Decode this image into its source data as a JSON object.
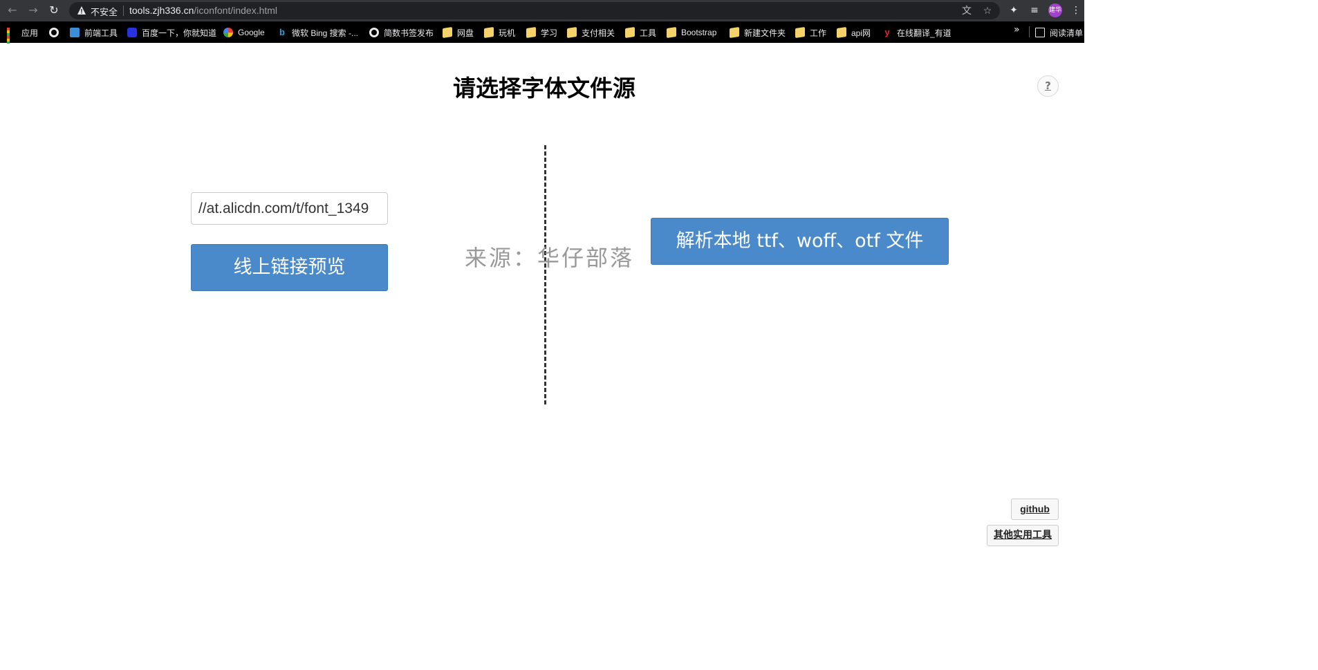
{
  "browser": {
    "not_secure_label": "不安全",
    "url_host": "tools.zjh336.cn",
    "url_path": "/iconfont/index.html",
    "avatar_text": "建华",
    "bookmarks": [
      {
        "label": "应用",
        "icon": "apps-icon"
      },
      {
        "label": "",
        "icon": "globe-icon"
      },
      {
        "label": "前端工具",
        "icon": "tool-site-icon"
      },
      {
        "label": "百度一下，你就知道",
        "icon": "baidu-icon"
      },
      {
        "label": "Google",
        "icon": "google-icon"
      },
      {
        "label": "微软 Bing 搜索 -...",
        "icon": "bing-icon"
      },
      {
        "label": "简数书签发布",
        "icon": "globe-icon"
      },
      {
        "label": "网盘",
        "icon": "folder-icon"
      },
      {
        "label": "玩机",
        "icon": "folder-icon"
      },
      {
        "label": "学习",
        "icon": "folder-icon"
      },
      {
        "label": "支付相关",
        "icon": "folder-icon"
      },
      {
        "label": "工具",
        "icon": "folder-icon"
      },
      {
        "label": "Bootstrap",
        "icon": "folder-icon"
      },
      {
        "label": "新建文件夹",
        "icon": "folder-icon"
      },
      {
        "label": "工作",
        "icon": "folder-icon"
      },
      {
        "label": "api网",
        "icon": "folder-icon"
      },
      {
        "label": "在线翻译_有道",
        "icon": "youdao-icon"
      }
    ],
    "more_label": "»",
    "reading_list_label": "阅读清单"
  },
  "page": {
    "title": "请选择字体文件源",
    "help_label": "?",
    "url_input_value": "//at.alicdn.com/t/font_1349",
    "preview_button_label": "线上链接预览",
    "source_text": "来源：华仔部落",
    "parse_local_button_label": "解析本地 ttf、woff、otf 文件",
    "github_label": "github",
    "other_tools_label": "其他实用工具"
  },
  "colors": {
    "primary_button": "#4a89ca",
    "divider": "#333333",
    "source_text": "#999999"
  }
}
